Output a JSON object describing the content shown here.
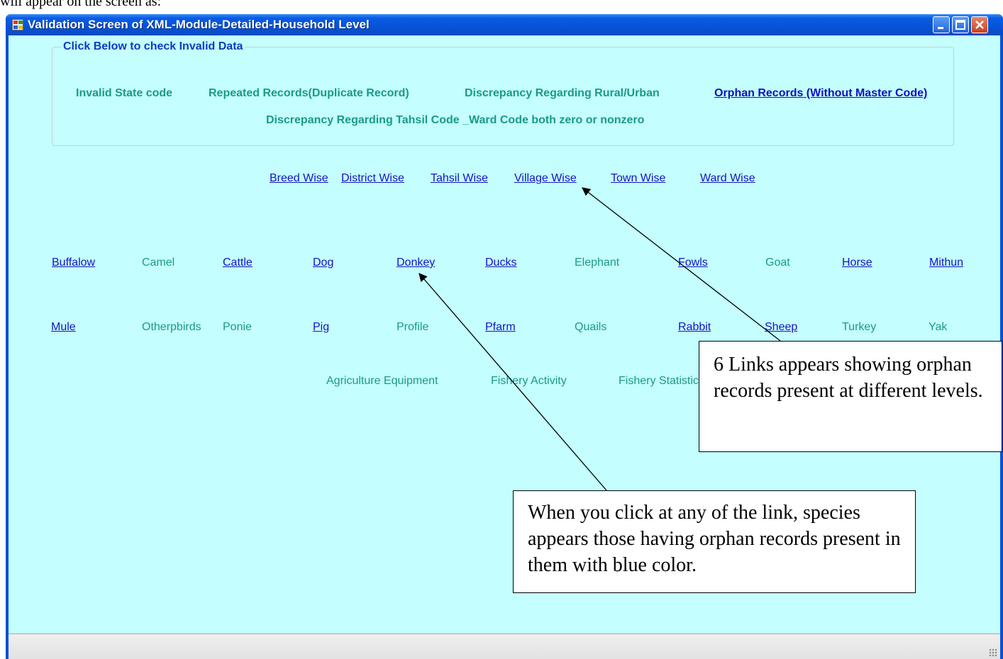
{
  "document": {
    "caption": "will appear on the screen as:"
  },
  "window": {
    "title": "Validation Screen of XML-Module-Detailed-Household Level",
    "controls": {
      "minimize": "minimize",
      "maximize": "maximize",
      "close": "close"
    }
  },
  "group": {
    "title": "Click Below to check Invalid Data",
    "buttons": {
      "invalid_state": "Invalid State code",
      "repeated": "Repeated Records(Duplicate Record)",
      "rural_urban": "Discrepancy Regarding Rural/Urban",
      "orphan": "Orphan Records (Without Master Code)",
      "tahsil_ward": "Discrepancy Regarding Tahsil Code _Ward Code both zero or nonzero"
    }
  },
  "levels": [
    "Breed Wise",
    "District Wise",
    "Tahsil Wise",
    "Village Wise",
    "Town Wise",
    "Ward Wise"
  ],
  "species_row1": [
    {
      "label": "Buffalow",
      "link": true
    },
    {
      "label": "Camel",
      "link": false
    },
    {
      "label": "Cattle",
      "link": true
    },
    {
      "label": "Dog",
      "link": true
    },
    {
      "label": "Donkey",
      "link": true
    },
    {
      "label": "Ducks",
      "link": true
    },
    {
      "label": "Elephant",
      "link": false
    },
    {
      "label": "Fowls",
      "link": true
    },
    {
      "label": "Goat",
      "link": false
    },
    {
      "label": "Horse",
      "link": true
    },
    {
      "label": "Mithun",
      "link": true
    }
  ],
  "species_row2": [
    {
      "label": "Mule",
      "link": true
    },
    {
      "label": "Otherpbirds",
      "link": false
    },
    {
      "label": "Ponie",
      "link": false
    },
    {
      "label": "Pig",
      "link": true
    },
    {
      "label": "Profile",
      "link": false
    },
    {
      "label": "Pfarm",
      "link": true
    },
    {
      "label": "Quails",
      "link": false
    },
    {
      "label": "Rabbit",
      "link": true
    },
    {
      "label": "Sheep",
      "link": true
    },
    {
      "label": "Turkey",
      "link": false
    },
    {
      "label": "Yak",
      "link": false
    }
  ],
  "species_row3": [
    {
      "label": "Agriculture Equipment",
      "link": false
    },
    {
      "label": "Fishery Activity",
      "link": false
    },
    {
      "label": "Fishery Statistics",
      "link": false
    }
  ],
  "callouts": {
    "levels_note": "6 Links appears showing orphan records present at different levels.",
    "species_note": "When you click at any of the link, species appears those having orphan records present in them with blue color."
  },
  "colors": {
    "window_bg": "#c4fefe",
    "link_blue": "#1414c4",
    "inactive_teal": "#1a9a8a",
    "titlebar_blue": "#0653d6"
  }
}
